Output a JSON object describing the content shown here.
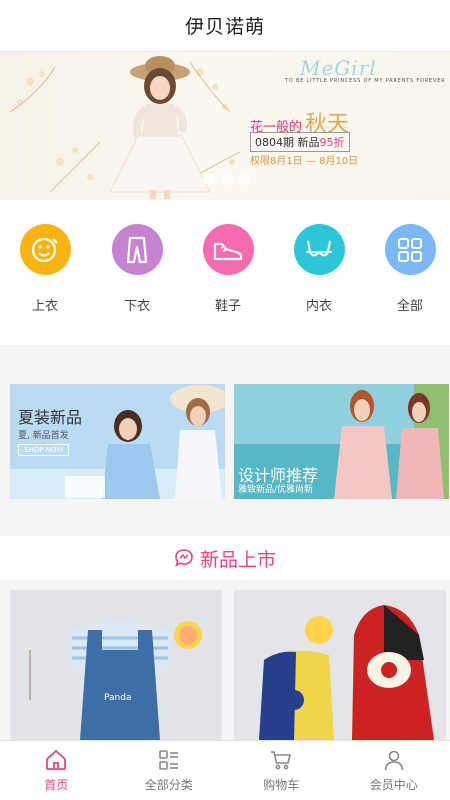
{
  "header": {
    "title": "伊贝诺萌"
  },
  "banner": {
    "script_text": "MeGirl",
    "tagline": "TO BE LITTLE PRINCESS OF MY PARENTS FOREVER",
    "headline_prefix": "花一般的",
    "headline_big": "秋天",
    "period_text": "0804期",
    "new_label": "新品",
    "discount_text": "95折",
    "date_range": "权限8月1日 — 8月10日",
    "slides_total": 3,
    "active_slide": 1
  },
  "categories": [
    {
      "label": "上衣",
      "color": "#f9b312",
      "icon": "smiley-shirt-icon"
    },
    {
      "label": "下衣",
      "color": "#c583d2",
      "icon": "pants-icon"
    },
    {
      "label": "鞋子",
      "color": "#f56bb0",
      "icon": "shoe-icon"
    },
    {
      "label": "内衣",
      "color": "#2bc7d8",
      "icon": "bra-icon"
    },
    {
      "label": "全部",
      "color": "#7cb8f5",
      "icon": "grid-icon"
    }
  ],
  "promos": [
    {
      "title": "夏装新品",
      "subtitle": "夏, 新品首发",
      "tag": "SHOP NOW"
    },
    {
      "title": "设计师推荐",
      "subtitle": "雅致新品/优雅尚新"
    }
  ],
  "section": {
    "title": "新品上市",
    "icon": "chat-bubble-icon"
  },
  "tabs": [
    {
      "label": "首页",
      "icon": "home-icon",
      "active": true
    },
    {
      "label": "全部分类",
      "icon": "list-icon",
      "active": false
    },
    {
      "label": "购物车",
      "icon": "cart-icon",
      "active": false
    },
    {
      "label": "会员中心",
      "icon": "user-icon",
      "active": false
    }
  ],
  "colors": {
    "accent": "#e7467c",
    "background": "#f5f5f5"
  }
}
